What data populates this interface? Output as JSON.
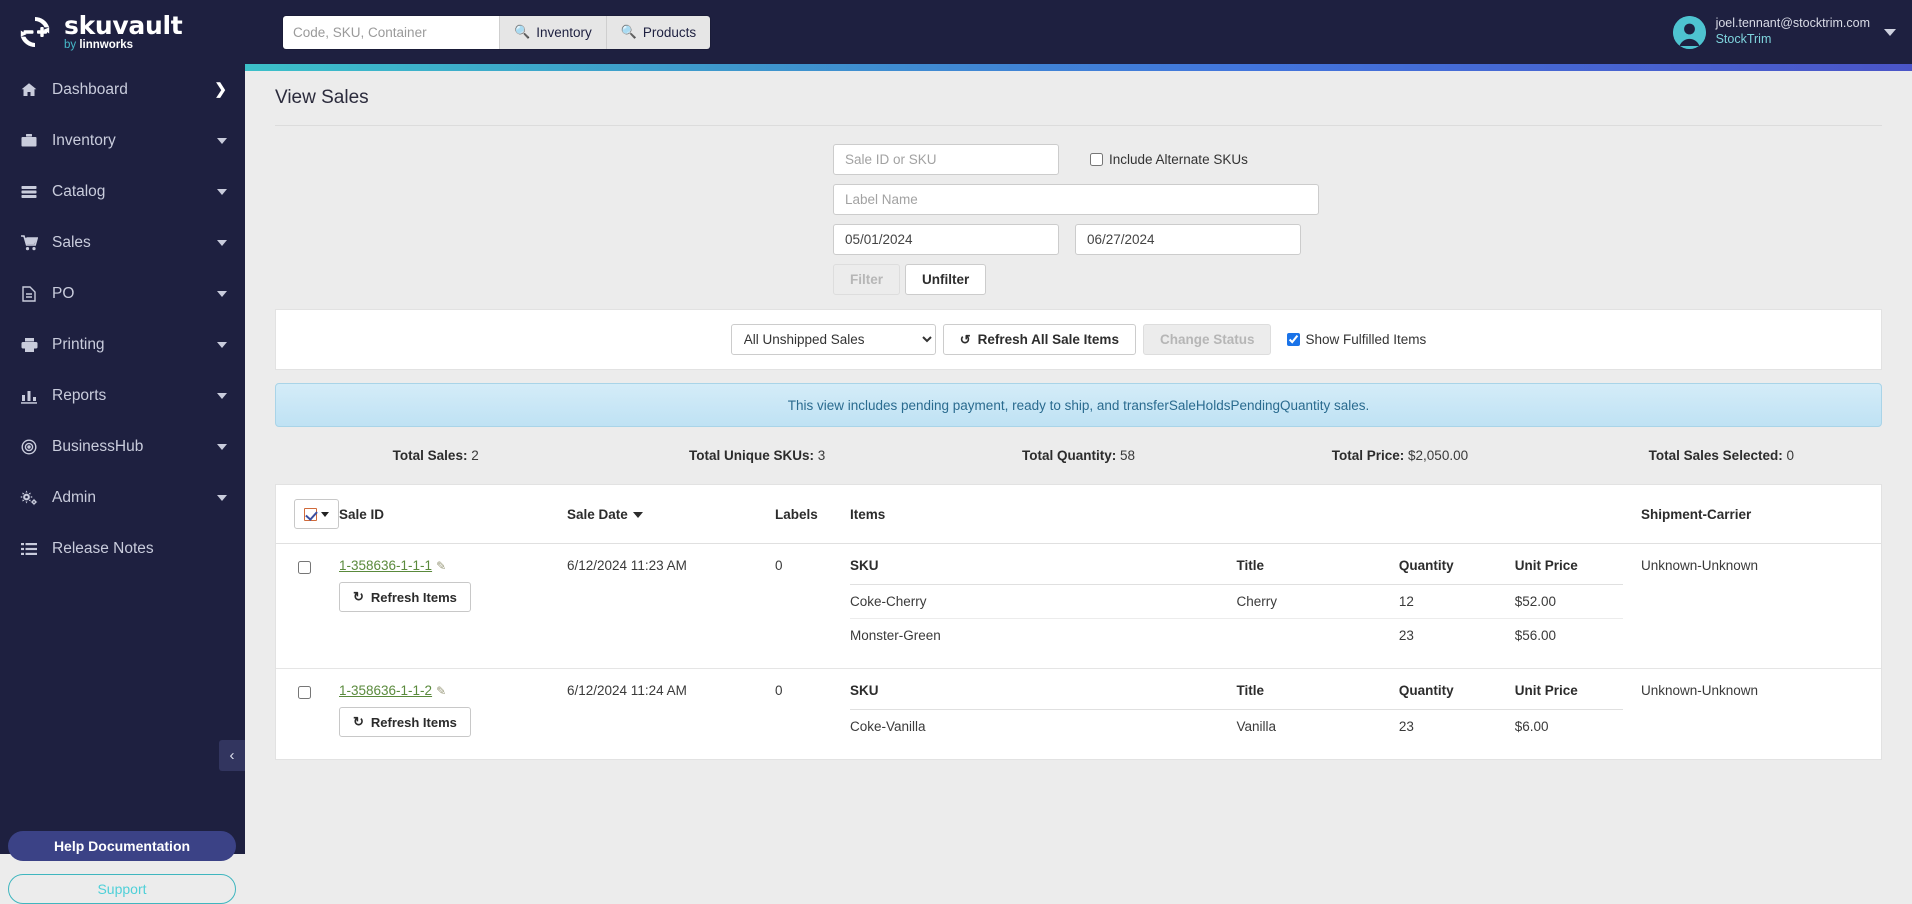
{
  "topbar": {
    "logo": {
      "word": "skuvault",
      "by": "by ",
      "brand": "linnworks",
      "icon": "skuvault-logo-icon"
    },
    "search": {
      "placeholder": "Code, SKU, Container",
      "value": "",
      "inventory_label": "Inventory",
      "products_label": "Products"
    },
    "user": {
      "email": "joel.tennant@stocktrim.com",
      "company": "StockTrim"
    }
  },
  "sidebar": {
    "items": [
      {
        "label": "Dashboard",
        "icon": "home-icon",
        "trailing": "chevron-right"
      },
      {
        "label": "Inventory",
        "icon": "briefcase-icon",
        "trailing": "caret-down"
      },
      {
        "label": "Catalog",
        "icon": "list-alt-icon",
        "trailing": "caret-down"
      },
      {
        "label": "Sales",
        "icon": "cart-icon",
        "trailing": "caret-down"
      },
      {
        "label": "PO",
        "icon": "document-icon",
        "trailing": "caret-down"
      },
      {
        "label": "Printing",
        "icon": "printer-icon",
        "trailing": "caret-down"
      },
      {
        "label": "Reports",
        "icon": "bar-chart-icon",
        "trailing": "caret-down"
      },
      {
        "label": "BusinessHub",
        "icon": "target-icon",
        "trailing": "caret-down"
      },
      {
        "label": "Admin",
        "icon": "gears-icon",
        "trailing": "caret-down"
      },
      {
        "label": "Release Notes",
        "icon": "list-icon",
        "trailing": "none"
      }
    ],
    "help_label": "Help Documentation",
    "support_label": "Support",
    "collapse_glyph": "‹"
  },
  "page": {
    "title": "View Sales"
  },
  "filters": {
    "sale_id_placeholder": "Sale ID or SKU",
    "sale_id_value": "",
    "include_alternate_skus_label": "Include Alternate SKUs",
    "include_alternate_skus_checked": false,
    "label_name_placeholder": "Label Name",
    "label_name_value": "",
    "date_from": "05/01/2024",
    "date_to": "06/27/2024",
    "filter_label": "Filter",
    "filter_disabled": true,
    "unfilter_label": "Unfilter"
  },
  "toolbar": {
    "status_selected": "All Unshipped Sales",
    "status_options": [
      "All Unshipped Sales"
    ],
    "refresh_all_label": "Refresh All Sale Items",
    "change_status_label": "Change Status",
    "change_status_disabled": true,
    "show_fulfilled_label": "Show Fulfilled Items",
    "show_fulfilled_checked": true
  },
  "banner": {
    "text": "This view includes pending payment, ready to ship, and transferSaleHoldsPendingQuantity sales."
  },
  "totals": [
    {
      "label": "Total Sales:",
      "value": "2"
    },
    {
      "label": "Total Unique SKUs:",
      "value": "3"
    },
    {
      "label": "Total Quantity:",
      "value": "58"
    },
    {
      "label": "Total Price:",
      "value": "$2,050.00"
    },
    {
      "label": "Total Sales Selected:",
      "value": "0"
    }
  ],
  "table": {
    "headers": {
      "sale_id": "Sale ID",
      "sale_date": "Sale Date",
      "labels": "Labels",
      "items": "Items",
      "shipment_carrier": "Shipment-Carrier"
    },
    "item_headers": {
      "sku": "SKU",
      "title": "Title",
      "quantity": "Quantity",
      "unit_price": "Unit Price"
    },
    "refresh_items_label": "Refresh Items",
    "rows": [
      {
        "sale_id": "1-358636-1-1-1",
        "sale_date": "6/12/2024 11:23 AM",
        "labels": "0",
        "shipment_carrier": "Unknown-Unknown",
        "selected": false,
        "items": [
          {
            "sku": "Coke-Cherry",
            "title": "Cherry",
            "quantity": "12",
            "unit_price": "$52.00"
          },
          {
            "sku": "Monster-Green",
            "title": "",
            "quantity": "23",
            "unit_price": "$56.00"
          }
        ]
      },
      {
        "sale_id": "1-358636-1-1-2",
        "sale_date": "6/12/2024 11:24 AM",
        "labels": "0",
        "shipment_carrier": "Unknown-Unknown",
        "selected": false,
        "items": [
          {
            "sku": "Coke-Vanilla",
            "title": "Vanilla",
            "quantity": "23",
            "unit_price": "$6.00"
          }
        ]
      }
    ]
  },
  "colors": {
    "navy": "#1e2040",
    "teal": "#4fd0d8",
    "link_green": "#5a8a3c",
    "banner_blue": "#bfe2f4",
    "accent_blue": "#3b4286"
  }
}
